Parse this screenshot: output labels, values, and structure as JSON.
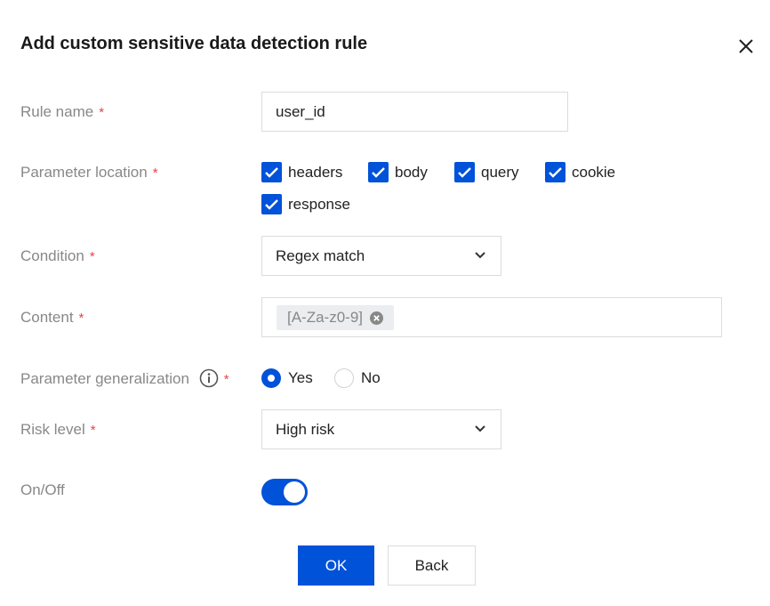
{
  "dialog": {
    "title": "Add custom sensitive data detection rule",
    "close_icon": "close-icon"
  },
  "form": {
    "rule_name": {
      "label": "Rule name",
      "required_mark": "*",
      "value": "user_id"
    },
    "parameter_location": {
      "label": "Parameter location",
      "required_mark": "*",
      "options": [
        {
          "label": "headers",
          "checked": true
        },
        {
          "label": "body",
          "checked": true
        },
        {
          "label": "query",
          "checked": true
        },
        {
          "label": "cookie",
          "checked": true
        },
        {
          "label": "response",
          "checked": true
        }
      ]
    },
    "condition": {
      "label": "Condition",
      "required_mark": "*",
      "selected": "Regex match"
    },
    "content": {
      "label": "Content",
      "required_mark": "*",
      "tags": [
        "[A-Za-z0-9]"
      ]
    },
    "parameter_generalization": {
      "label": "Parameter generalization",
      "required_mark": "*",
      "info_icon": "info-icon",
      "options": [
        {
          "label": "Yes",
          "selected": true
        },
        {
          "label": "No",
          "selected": false
        }
      ]
    },
    "risk_level": {
      "label": "Risk level",
      "required_mark": "*",
      "selected": "High risk"
    },
    "on_off": {
      "label": "On/Off",
      "enabled": true
    }
  },
  "footer": {
    "ok_label": "OK",
    "back_label": "Back"
  },
  "colors": {
    "primary": "#0052d9",
    "required": "#e54545",
    "label": "#888888",
    "border": "#dcdcdc"
  }
}
